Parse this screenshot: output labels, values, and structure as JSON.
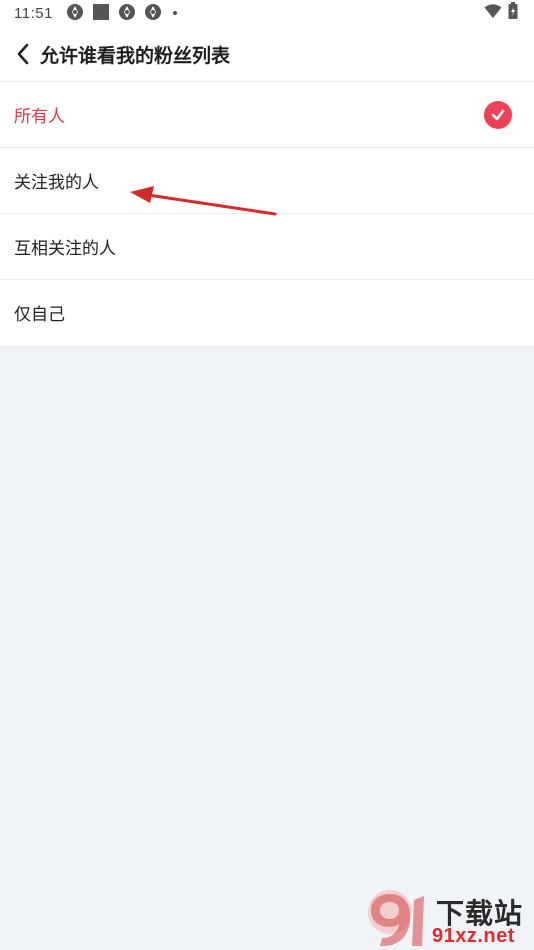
{
  "status_bar": {
    "time": "11:51",
    "left_icons": [
      "notification-icon",
      "square-icon",
      "notification-icon",
      "notification-icon",
      "dot-icon"
    ],
    "right_icons": [
      "wifi-icon",
      "battery-charging-icon"
    ]
  },
  "nav": {
    "back_icon": "chevron-left-icon",
    "title": "允许谁看我的粉丝列表"
  },
  "options": [
    {
      "label": "所有人",
      "selected": true
    },
    {
      "label": "关注我的人",
      "selected": false
    },
    {
      "label": "互相关注的人",
      "selected": false
    },
    {
      "label": "仅自己",
      "selected": false
    }
  ],
  "colors": {
    "accent": "#e8364f",
    "check_badge": "#f04058",
    "background": "#f0f3f7",
    "annotation_arrow": "#d42a2a"
  },
  "watermark": {
    "brand": "下载站",
    "site": "91xz.net"
  }
}
